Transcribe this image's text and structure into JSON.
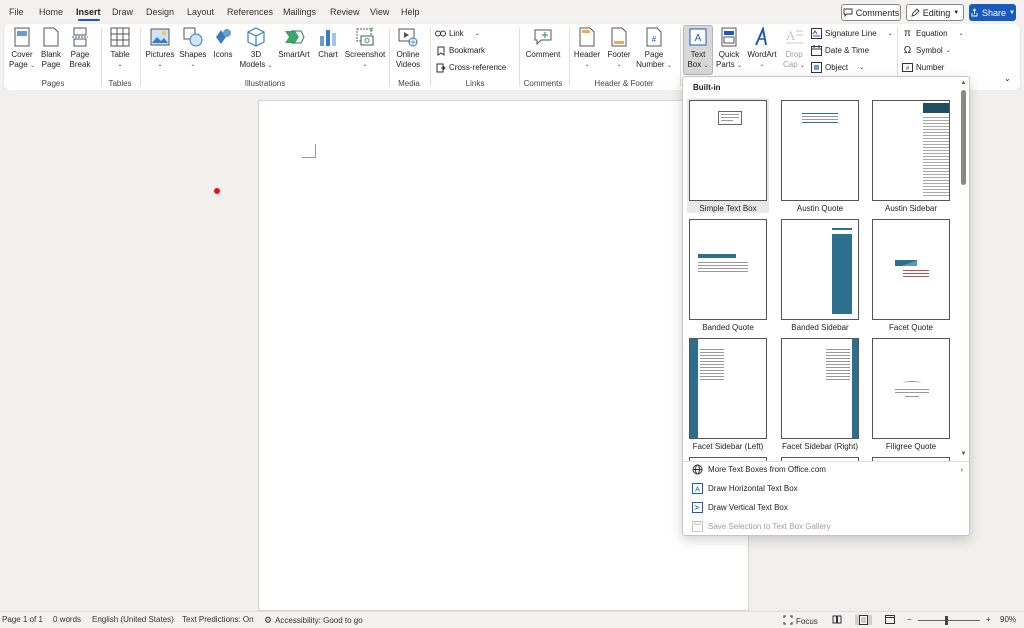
{
  "tabs": [
    "File",
    "Home",
    "Insert",
    "Draw",
    "Design",
    "Layout",
    "References",
    "Mailings",
    "Review",
    "View",
    "Help"
  ],
  "active_tab": "Insert",
  "top_buttons": {
    "comments": "Comments",
    "editing": "Editing",
    "share": "Share"
  },
  "ribbon": {
    "pages": {
      "cover_page": [
        "Cover",
        "Page"
      ],
      "blank_page": [
        "Blank",
        "Page"
      ],
      "page_break": [
        "Page",
        "Break"
      ],
      "label": "Pages"
    },
    "tables": {
      "table": "Table",
      "label": "Tables"
    },
    "illustrations": {
      "pictures": "Pictures",
      "shapes": "Shapes",
      "icons": "Icons",
      "models": [
        "3D",
        "Models"
      ],
      "smartart": "SmartArt",
      "chart": "Chart",
      "screenshot": "Screenshot",
      "label": "Illustrations"
    },
    "media": {
      "online_videos": [
        "Online",
        "Videos"
      ],
      "label": "Media"
    },
    "links": {
      "link": "Link",
      "bookmark": "Bookmark",
      "cross_reference": "Cross-reference",
      "label": "Links"
    },
    "comments": {
      "comment": "Comment",
      "label": "Comments"
    },
    "header_footer": {
      "header": "Header",
      "footer": "Footer",
      "page_number": [
        "Page",
        "Number"
      ],
      "label": "Header & Footer"
    },
    "text": {
      "text_box": [
        "Text",
        "Box"
      ],
      "quick_parts": [
        "Quick",
        "Parts"
      ],
      "wordart": "WordArt",
      "drop_cap": [
        "Drop",
        "Cap"
      ],
      "signature_line": "Signature Line",
      "date_time": "Date & Time",
      "object": "Object"
    },
    "symbols": {
      "equation": "Equation",
      "symbol": "Symbol",
      "number": "Number"
    }
  },
  "gallery": {
    "header": "Built-in",
    "items": [
      "Simple Text Box",
      "Austin Quote",
      "Austin Sidebar",
      "Banded Quote",
      "Banded Sidebar",
      "Facet Quote",
      "Facet Sidebar (Left)",
      "Facet Sidebar (Right)",
      "Filigree Quote"
    ],
    "menu": {
      "more": "More Text Boxes from Office.com",
      "draw_horizontal": "Draw Horizontal Text Box",
      "draw_vertical": "Draw Vertical Text Box",
      "save_selection": "Save Selection to Text Box Gallery"
    }
  },
  "status": {
    "page": "Page 1 of 1",
    "words": "0 words",
    "language": "English (United States)",
    "predictions": "Text Predictions: On",
    "accessibility": "Accessibility: Good to go",
    "focus": "Focus",
    "zoom": "90%",
    "zoom_minus": "−",
    "zoom_plus": "+"
  },
  "colors": {
    "accent": "#185abd",
    "teal_thumb": "#2e6f8e",
    "red_dot": "#e81123"
  }
}
